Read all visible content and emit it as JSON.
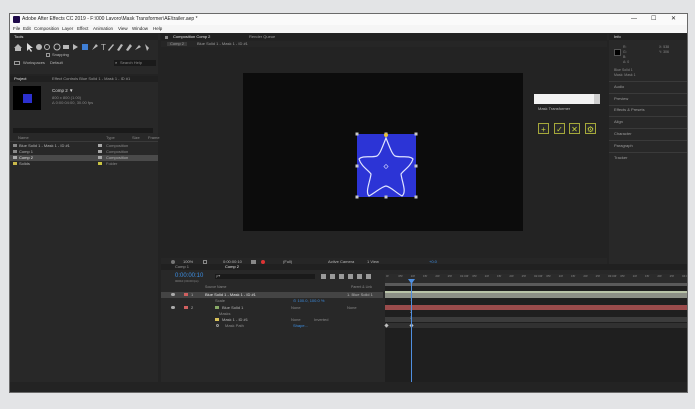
{
  "window": {
    "title": "Adobe After Effects CC 2019 - F:\\000 Lavoro\\Mask Transformer\\AE\\trailer.aep *",
    "controls": [
      "—",
      "☐",
      "✕"
    ]
  },
  "menu": [
    "File",
    "Edit",
    "Composition",
    "Layer",
    "Effect",
    "Animation",
    "View",
    "Window",
    "Help"
  ],
  "tools": {
    "panel_title": "Tools",
    "snapping": "Snapping",
    "workspaces_label": "Workspaces",
    "workspace": "Default",
    "search_placeholder": "Search Help"
  },
  "project": {
    "tab": "Project",
    "effect_tab": "Effect Controls Blue Solid 1 - Mask 1 - ID #1",
    "selected_name": "Comp 2 ▼",
    "selected_info1": "800 x 800 (1.00)",
    "selected_info2": "Δ 0:00:04:00, 30.00 fps",
    "columns": {
      "name": "Name",
      "type": "Type",
      "size": "Size",
      "frame": "Frame"
    },
    "items": [
      {
        "name": "Blue Solid 1 - Mask 1 - ID #1",
        "type": "Composition",
        "color": "#a7a7a7"
      },
      {
        "name": "Comp 1",
        "type": "Composition",
        "color": "#a7a7a7"
      },
      {
        "name": "Comp 2",
        "type": "Composition",
        "color": "#a7a7a7"
      },
      {
        "name": "Solids",
        "type": "Folder",
        "color": "#c9c442"
      }
    ],
    "bpc": "8 bpc"
  },
  "composition": {
    "tab": "Composition Comp 2",
    "render_tab": "Render Queue",
    "breadcrumbs": [
      "Comp 2",
      "Blue Solid 1 - Mask 1 - ID #1"
    ],
    "zoom": "100%",
    "timecode": "0:00:00:10",
    "resolution": "(Full)",
    "camera": "Active Camera",
    "views": "1 View",
    "exposure": "+0.0"
  },
  "mask_transformer": {
    "title": "Mask Transformer",
    "buttons": [
      "+",
      "✓",
      "✕",
      "⚙"
    ]
  },
  "right_panels": {
    "info": "Info",
    "info_values": [
      "X: 538",
      "Y: 306",
      "R:",
      "G:",
      "B:",
      "A: 0"
    ],
    "info_layer": "Blue Solid 1",
    "info_mask": "Mask: Mask 1",
    "items": [
      "Audio",
      "Preview",
      "Effects & Presets",
      "Align",
      "Character",
      "Paragraph",
      "Tracker"
    ]
  },
  "timeline": {
    "tabs": [
      "Comp 1",
      "Comp 2"
    ],
    "timecode": "0:00:00:10",
    "timecode_sub": "00010 (30.00 fps)",
    "search_placeholder": "ρ▾",
    "col_source": "Source Name",
    "col_parent": "Parent & Link",
    "rows": [
      {
        "num": "1",
        "name": "Blue Solid 1 - Mask 1 - ID #1",
        "parent": "1. Blue Solid 1",
        "sel": true
      },
      {
        "num": "",
        "name": "Scale",
        "value": "⊙ 100.0, 100.0 %",
        "sel": false
      },
      {
        "num": "2",
        "name": "Blue Solid 1",
        "mode": "None",
        "parent": "None",
        "sel": false
      },
      {
        "num": "",
        "name": "Masks",
        "sel": false
      },
      {
        "num": "",
        "name": "Mask 1 - ID #1",
        "mode": "None",
        "extra": "Inverted",
        "sel": false
      },
      {
        "num": "",
        "name": "Mask Path",
        "value": "Shape...",
        "sel": false
      }
    ],
    "ruler": [
      "0f",
      "05f",
      "10f",
      "15f",
      "20f",
      "25f",
      "01:00f",
      "05f",
      "10f",
      "15f",
      "20f",
      "25f",
      "02:00f",
      "05f",
      "10f",
      "15f",
      "20f",
      "25f",
      "03:00f",
      "05f",
      "10f",
      "15f",
      "20f",
      "25f",
      "04:0"
    ],
    "keyframe_numbers": [
      "1",
      "2",
      "3"
    ]
  }
}
